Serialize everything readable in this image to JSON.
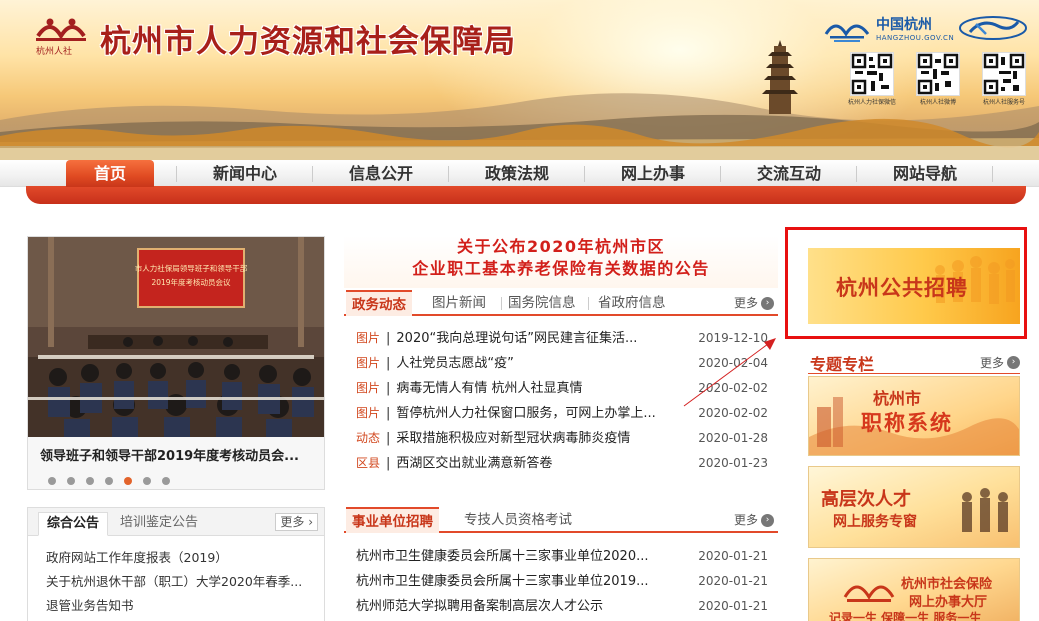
{
  "banner": {
    "site_title": "杭州市人力资源和社会保障局",
    "emblem_caption": "杭州人社",
    "hz_logo_cn": "中国杭州",
    "hz_logo_en": "HANGZHOU.GOV.CN",
    "qr_captions": [
      "杭州人力社保微信",
      "杭州人社微博",
      "杭州人社服务号"
    ],
    "colors": {
      "title": "#a8201a",
      "accent": "#e04b22"
    }
  },
  "nav": {
    "items": [
      {
        "label": "首页",
        "active": true
      },
      {
        "label": "新闻中心"
      },
      {
        "label": "信息公开"
      },
      {
        "label": "政策法规"
      },
      {
        "label": "网上办事"
      },
      {
        "label": "交流互动"
      },
      {
        "label": "网站导航"
      }
    ]
  },
  "slider": {
    "photo_screen_text_line1": "市人力社保局领导班子和领导干部",
    "photo_screen_text_line2": "2019年度考核动员会议",
    "caption": "领导班子和领导干部2019年度考核动员会...",
    "dot_count": 6,
    "active_dot": 4
  },
  "notice": {
    "tabs": [
      "综合公告",
      "培训鉴定公告"
    ],
    "more": "更多",
    "items": [
      "政府网站工作年度报表（2019）",
      "关于杭州退休干部（职工）大学2020年春季...",
      "退管业务告知书"
    ]
  },
  "headline": {
    "line1": "关于公布2020年杭州市区",
    "line2": "企业职工基本养老保险有关数据的公告"
  },
  "news": {
    "tabs": [
      "政务动态",
      "图片新闻",
      "国务院信息",
      "省政府信息"
    ],
    "more": "更多",
    "items": [
      {
        "tag": "图片",
        "title": "2020“我向总理说句话”网民建言征集活...",
        "date": "2019-12-10"
      },
      {
        "tag": "图片",
        "title": "人社党员志愿战“疫”",
        "date": "2020-02-04"
      },
      {
        "tag": "图片",
        "title": "病毒无情人有情 杭州人社显真情",
        "date": "2020-02-02"
      },
      {
        "tag": "图片",
        "title": "暂停杭州人力社保窗口服务，可网上办掌上...",
        "date": "2020-02-02"
      },
      {
        "tag": "动态",
        "title": "采取措施积极应对新型冠状病毒肺炎疫情",
        "date": "2020-01-28"
      },
      {
        "tag": "区县",
        "title": "西湖区交出就业满意新答卷",
        "date": "2020-01-23"
      }
    ]
  },
  "jobs": {
    "tabs": [
      "事业单位招聘",
      "专技人员资格考试"
    ],
    "more": "更多",
    "items": [
      {
        "title": "杭州市卫生健康委员会所属十三家事业单位2020...",
        "date": "2020-01-21"
      },
      {
        "title": "杭州市卫生健康委员会所属十三家事业单位2019...",
        "date": "2020-01-21"
      },
      {
        "title": "杭州师范大学拟聘用备案制高层次人才公示",
        "date": "2020-01-21"
      }
    ]
  },
  "right": {
    "recruit_banner": "杭州公共招聘",
    "special_title": "专题专栏",
    "special_more": "更多",
    "promo1_line1": "杭州市",
    "promo1_line2": "职称系统",
    "promo2_line1": "高层次人才",
    "promo2_line2": "网上服务专窗",
    "promo3_line1": "杭州市社会保险",
    "promo3_line2": "网上办事大厅",
    "promo3_line3": "记录一生 保障一生 服务一生"
  }
}
